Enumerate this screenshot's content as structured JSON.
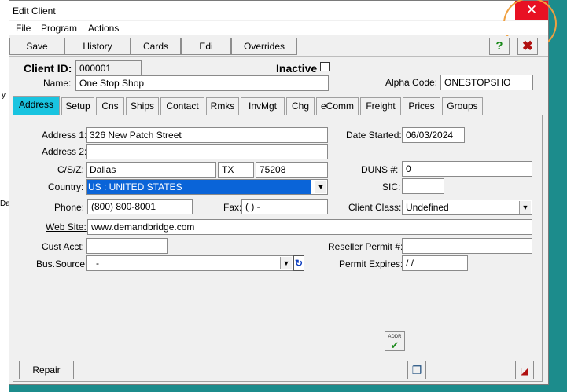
{
  "background": {
    "frag1": "y",
    "frag2": "Da"
  },
  "window": {
    "title": "Edit Client"
  },
  "menu": [
    "File",
    "Program",
    "Actions"
  ],
  "toolbar": {
    "save": "Save",
    "history": "History",
    "cards": "Cards",
    "edi": "Edi",
    "overrides": "Overrides"
  },
  "header": {
    "client_id_label": "Client ID:",
    "client_id": "000001",
    "inactive_label": "Inactive",
    "name_label": "Name:",
    "name": "One Stop Shop",
    "alpha_code_label": "Alpha Code:",
    "alpha_code": "ONESTOPSHO"
  },
  "tabs": [
    "Address",
    "Setup",
    "Cns",
    "Ships",
    "Contact",
    "Rmks",
    "InvMgt",
    "Chg",
    "eComm",
    "Freight",
    "Prices",
    "Groups"
  ],
  "form": {
    "address1_label": "Address 1:",
    "address1": "326 New Patch Street",
    "address2_label": "Address 2:",
    "address2": "",
    "csz_label": "C/S/Z:",
    "city": "Dallas",
    "state": "TX",
    "zip": "75208",
    "country_label": "Country:",
    "country": "US : UNITED STATES",
    "phone_label": "Phone:",
    "phone": "(800) 800-8001",
    "fax_label": "Fax:",
    "fax": "(  )   -",
    "website_label": "Web Site:",
    "website": "www.demandbridge.com",
    "cust_acct_label": "Cust Acct:",
    "cust_acct": "",
    "bus_source_label": "Bus.Source:",
    "bus_source": "-",
    "date_started_label": "Date Started:",
    "date_started": "06/03/2024",
    "duns_label": "DUNS #:",
    "duns": "0",
    "sic_label": "SIC:",
    "sic": "",
    "client_class_label": "Client Class:",
    "client_class": "Undefined",
    "reseller_permit_label": "Reseller Permit #:",
    "reseller_permit": "",
    "permit_expires_label": "Permit Expires:",
    "permit_expires": " / /",
    "addr_icon_text": "ADDR"
  },
  "footer": {
    "repair": "Repair"
  }
}
